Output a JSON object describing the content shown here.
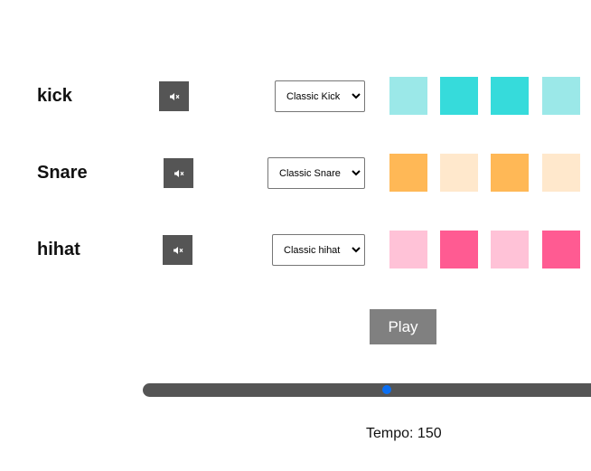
{
  "tracks": [
    {
      "name": "kick",
      "sound": "Classic Kick",
      "mute_icon": "speaker-muted-icon",
      "color_on": "#36dbdb",
      "color_off": "#9be8e8",
      "steps": [
        false,
        true,
        true,
        false
      ]
    },
    {
      "name": "Snare",
      "sound": "Classic Snare",
      "mute_icon": "speaker-muted-icon",
      "color_on": "#ffb856",
      "color_off": "#ffe8cc",
      "steps": [
        true,
        false,
        true,
        false
      ]
    },
    {
      "name": "hihat",
      "sound": "Classic hihat",
      "mute_icon": "speaker-muted-icon",
      "color_on": "#ff5b92",
      "color_off": "#ffc2d7",
      "steps": [
        false,
        true,
        false,
        true
      ]
    }
  ],
  "controls": {
    "play_label": "Play",
    "tempo_text": "Tempo: 150",
    "tempo_slider_fraction": 0.53,
    "slider_color": "#0b6ff2"
  }
}
